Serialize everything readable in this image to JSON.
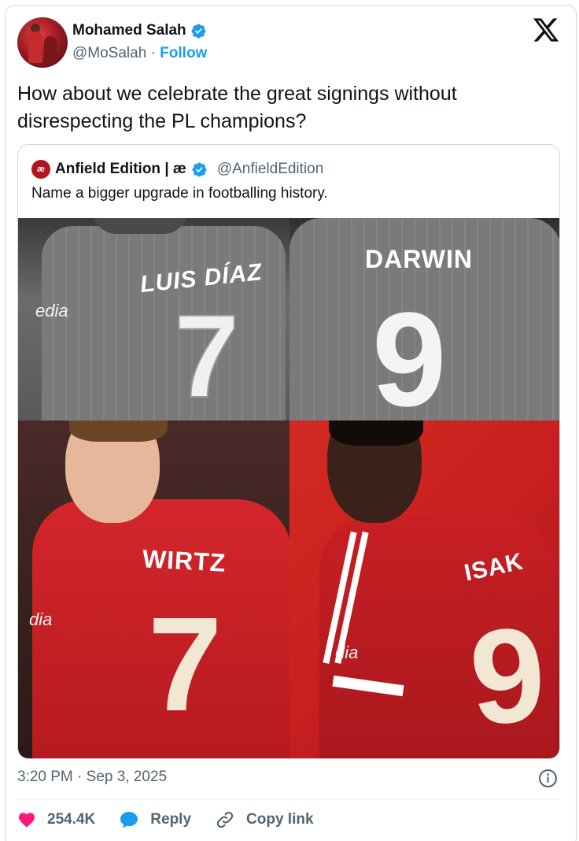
{
  "author": {
    "name": "Mohamed Salah",
    "handle": "@MoSalah",
    "separator": "·",
    "follow_label": "Follow"
  },
  "tweet": {
    "text": "How about we celebrate the great signings without disrespecting the PL champions?"
  },
  "quote": {
    "avatar_text": "æ",
    "name": "Anfield Edition | æ",
    "handle": "@AnfieldEdition",
    "text": "Name a bigger upgrade in footballing history."
  },
  "media": {
    "top_left": {
      "name": "LUIS DÍAZ",
      "number": "7",
      "sponsor": "edia"
    },
    "top_right": {
      "name": "DARWIN",
      "number": "9"
    },
    "bottom_left": {
      "name": "WIRTZ",
      "number": "7",
      "sponsor": "dia"
    },
    "bottom_right": {
      "name": "ISAK",
      "number": "9",
      "sponsor": "dia"
    }
  },
  "meta": {
    "timestamp": "3:20 PM · Sep 3, 2025"
  },
  "actions": {
    "likes": "254.4K",
    "reply_label": "Reply",
    "copy_label": "Copy link"
  },
  "colors": {
    "accent": "#1d9bf0",
    "like": "#f91880",
    "secondary_text": "#536471"
  }
}
